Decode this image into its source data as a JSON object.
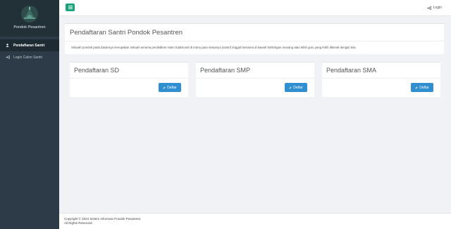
{
  "sidebar": {
    "brand": "Pondok Pesantren",
    "items": [
      {
        "label": "Pendaftaran Santri",
        "icon": "user-icon",
        "active": true
      },
      {
        "label": "Login Calon Santri",
        "icon": "sign-in-icon",
        "active": false
      }
    ]
  },
  "topbar": {
    "toggle_icon": "menu-icon",
    "login_label": "Login"
  },
  "header": {
    "title": "Pendaftaran Santri Pondok Pesantren",
    "description": "Sebuah pondok pada dasarnya merupakan sebuah asrama pendidikan Islam tradisional di mana para siswanya (santri) tinggal bersama di bawah bimbingan seorang atau lebih guru yang lebih dikenal dengan kiai."
  },
  "cards": [
    {
      "title": "Pendaftaran SD",
      "button": "Daftar"
    },
    {
      "title": "Pendaftaran SMP",
      "button": "Daftar"
    },
    {
      "title": "Pendaftaran SMA",
      "button": "Daftar"
    }
  ],
  "footer": {
    "copyright": "Copyright © 2024 Sistem Informasi Pondok Pesantren.",
    "rights": "All Rights Reserved."
  },
  "colors": {
    "sidebar": "#2c3b47",
    "accent_green": "#1aa37a",
    "button_blue": "#2f8fd0"
  }
}
